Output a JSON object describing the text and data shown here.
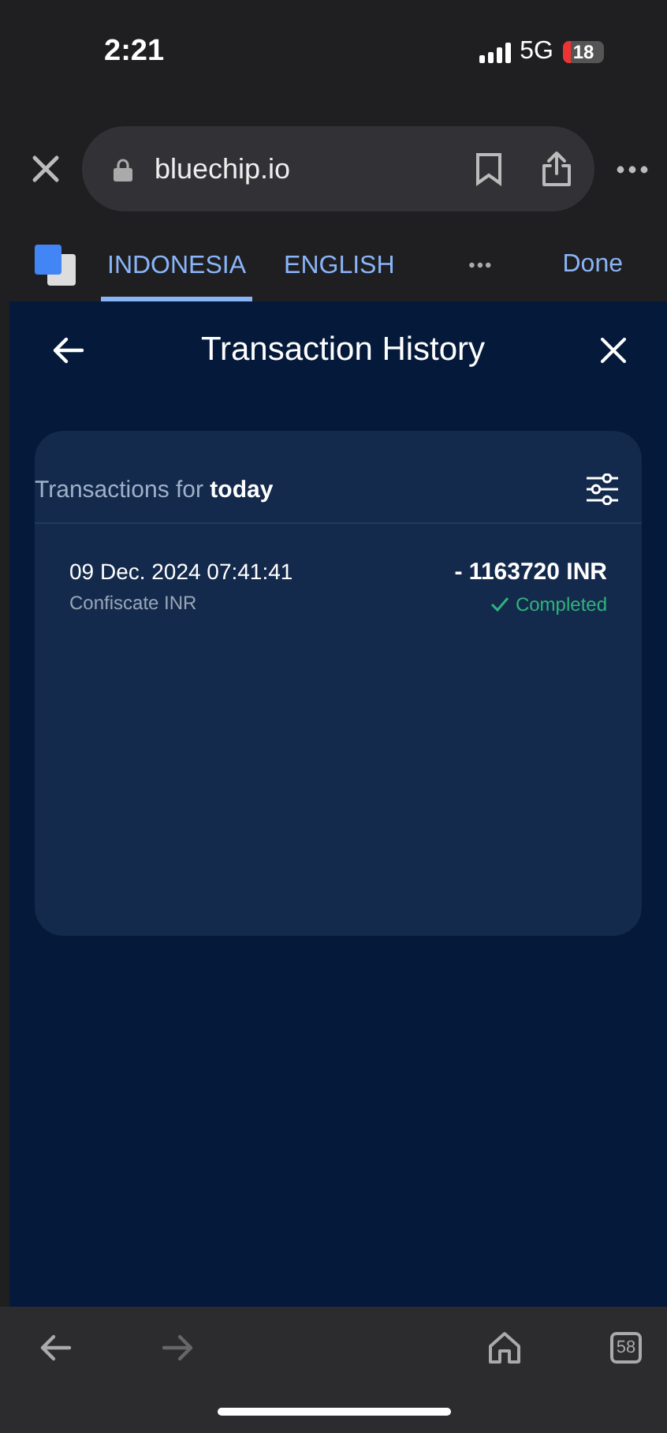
{
  "status_bar": {
    "time": "2:21",
    "network": "5G",
    "battery": "18"
  },
  "browser_bar": {
    "url": "bluechip.io"
  },
  "translate_bar": {
    "languages": [
      {
        "label": "INDONESIA",
        "selected": true
      },
      {
        "label": "ENGLISH",
        "selected": false
      }
    ],
    "more": "•••",
    "done": "Done"
  },
  "page": {
    "title": "Transaction History",
    "section_title": "Transactions for **today**",
    "transactions": [
      {
        "datetime": "09 Dec. 2024 07:41:41",
        "description": "Confiscate INR",
        "amount": "- 1163720 INR",
        "status": "Completed"
      }
    ]
  },
  "toolbar": {
    "back_disabled": false,
    "forward_disabled": true,
    "tabs_count": "58"
  }
}
